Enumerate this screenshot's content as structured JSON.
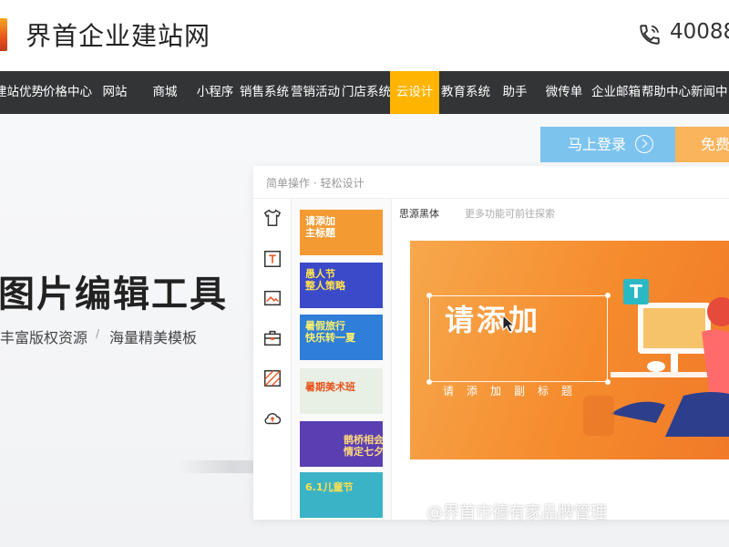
{
  "header": {
    "logo_text": "界首企业建站网",
    "phone_text": "40088"
  },
  "nav": {
    "items": [
      {
        "label": "建站优势"
      },
      {
        "label": "价格中心"
      },
      {
        "label": "网站"
      },
      {
        "label": "商城"
      },
      {
        "label": "小程序"
      },
      {
        "label": "销售系统"
      },
      {
        "label": "营销活动"
      },
      {
        "label": "门店系统"
      },
      {
        "label": "云设计",
        "active": true
      },
      {
        "label": "教育系统"
      },
      {
        "label": "助手"
      },
      {
        "label": "微传单"
      },
      {
        "label": "企业邮箱"
      },
      {
        "label": "帮助中心"
      },
      {
        "label": "新闻中"
      }
    ],
    "active_color": "#ffb400"
  },
  "hero": {
    "login_label": "马上登录",
    "free_label": "免费",
    "title": "图片编辑工具",
    "sub1": "丰富版权资源",
    "separator": "/",
    "sub2": "海量精美模板"
  },
  "editor": {
    "header_text": "简单操作 · 轻松设计",
    "font_name": "思源黑体",
    "hint": "更多功能可前往探索",
    "tools": [
      "tshirt-icon",
      "text-icon",
      "image-icon",
      "briefcase-icon",
      "pattern-icon",
      "cloud-upload-icon"
    ],
    "thumbnails": [
      {
        "text": "请添加\n主标题",
        "color": "#f39a33"
      },
      {
        "text": "愚人节\n整人策略",
        "color": "#3b4ac9"
      },
      {
        "text": "暑假旅行\n快乐转一夏",
        "color": "#2f7ed8"
      },
      {
        "text": "暑期美术班",
        "color": "#e8f0e6"
      },
      {
        "text": "鹊桥相会\n情定七夕",
        "color": "#5a3fb3"
      },
      {
        "text": "6.1儿童节",
        "color": "#3bb3c7"
      }
    ],
    "canvas": {
      "title": "请添加",
      "subtitle": "请添加副标题",
      "t_badge": "T"
    }
  },
  "watermark": "@界首市德有家品牌管理"
}
